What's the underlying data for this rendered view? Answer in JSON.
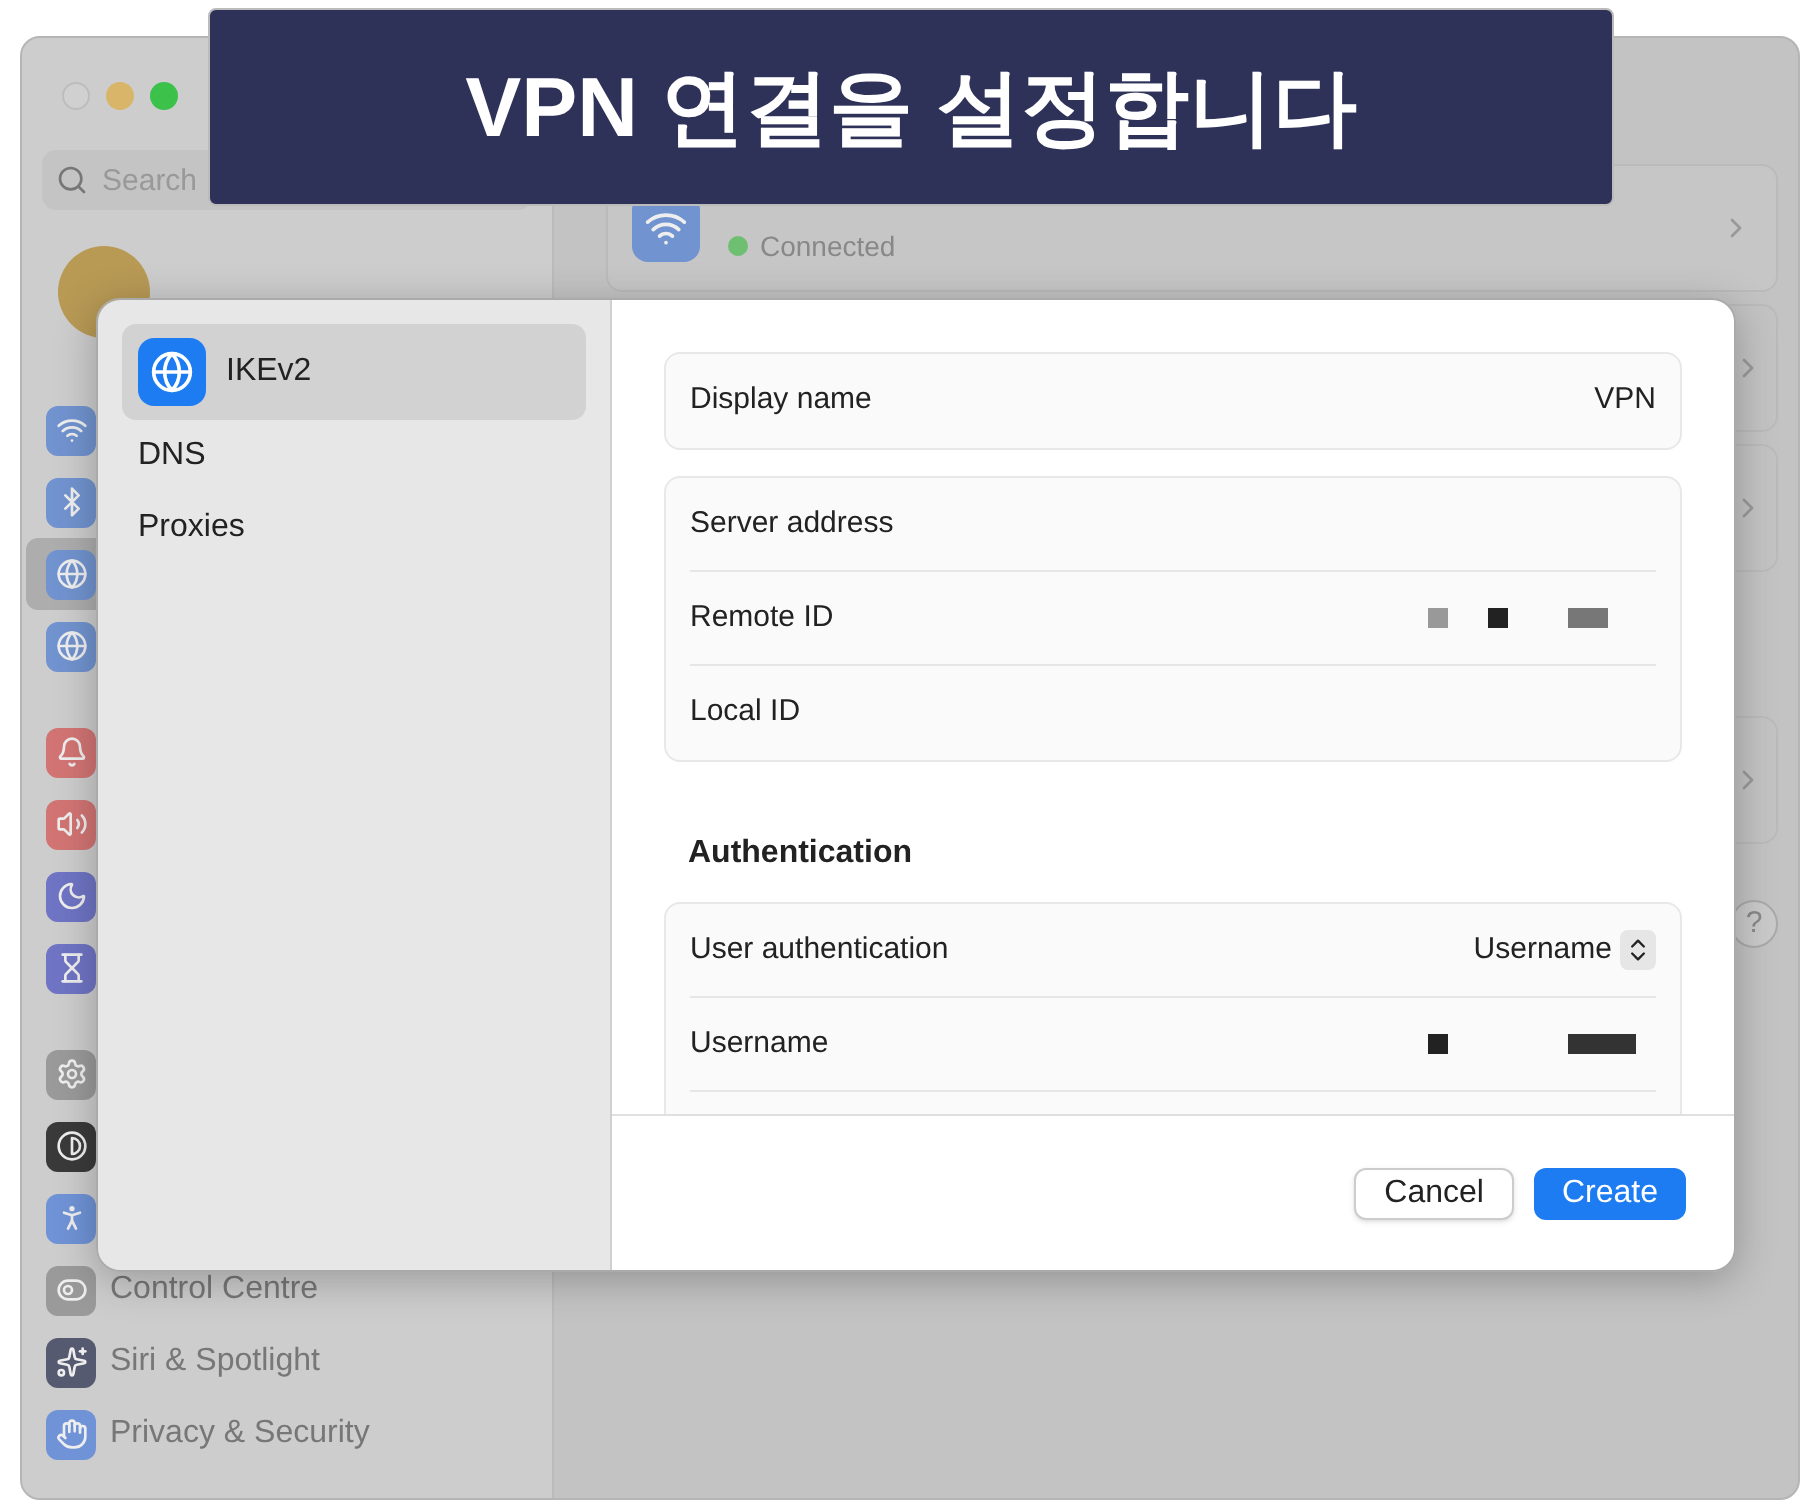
{
  "banner": {
    "title": "VPN 연결을 설정합니다"
  },
  "window": {
    "search": {
      "placeholder": "Search"
    },
    "sidebar": {
      "items": [
        {
          "selected": false
        },
        {
          "selected": false
        },
        {
          "selected": true
        },
        {
          "selected": false
        },
        {
          "selected": false
        },
        {
          "selected": false
        },
        {
          "selected": false
        },
        {
          "selected": false
        },
        {
          "selected": false
        },
        {
          "selected": false
        },
        {
          "selected": false
        },
        {
          "label": "Control Centre",
          "selected": false
        },
        {
          "label": "Siri & Spotlight",
          "selected": false
        },
        {
          "label": "Privacy & Security",
          "selected": false
        }
      ]
    },
    "wifi": {
      "status": "Connected",
      "connected": true
    },
    "help": "?"
  },
  "dialog": {
    "sidebar": [
      {
        "label": "IKEv2",
        "selected": true
      },
      {
        "label": "DNS",
        "selected": false
      },
      {
        "label": "Proxies",
        "selected": false
      }
    ],
    "groups": [
      {
        "rows": [
          {
            "label": "Display name",
            "value": "VPN"
          }
        ]
      },
      {
        "rows": [
          {
            "label": "Server address"
          },
          {
            "label": "Remote ID",
            "redacted": true
          },
          {
            "label": "Local ID"
          }
        ]
      },
      {
        "heading": "Authentication",
        "rows": [
          {
            "label": "User authentication",
            "select": "Username"
          },
          {
            "label": "Username",
            "redacted": true
          }
        ]
      }
    ],
    "buttons": [
      {
        "label": "Cancel",
        "kind": "secondary"
      },
      {
        "label": "Create",
        "kind": "primary"
      }
    ]
  }
}
